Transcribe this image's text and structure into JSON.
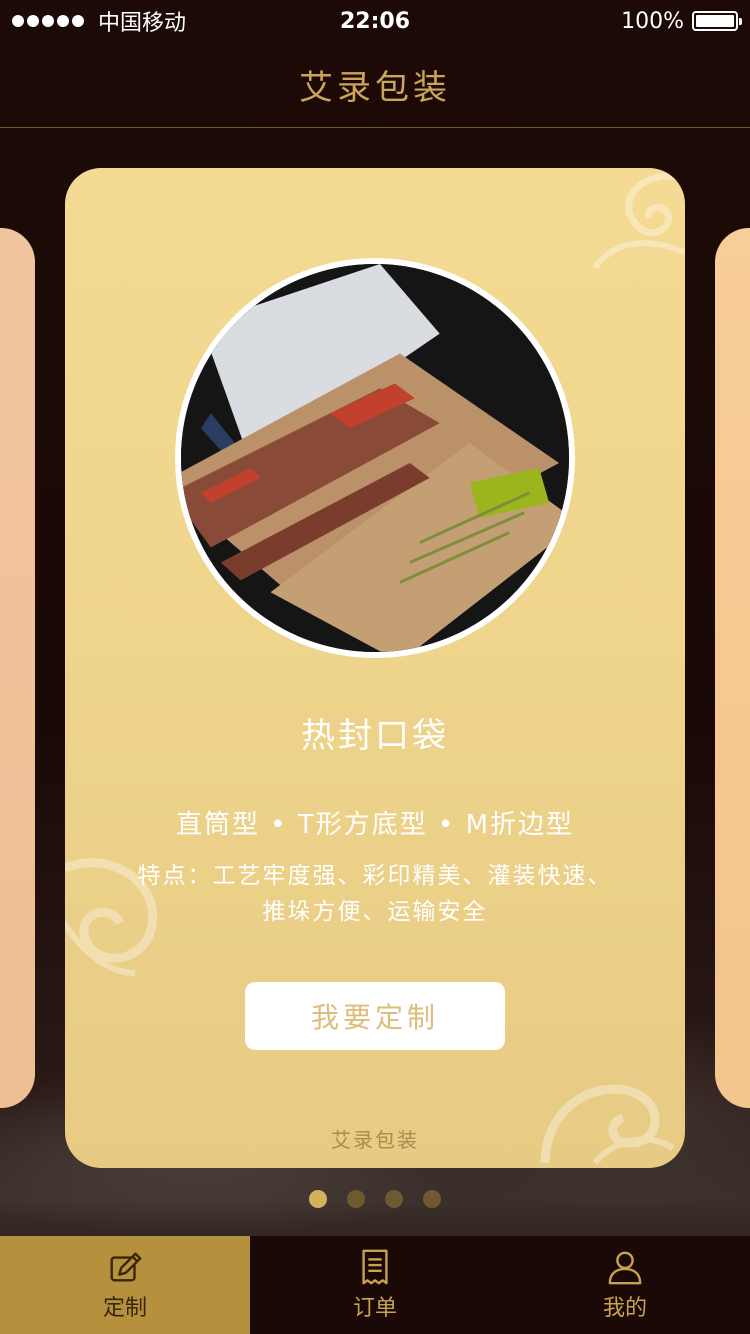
{
  "status_bar": {
    "carrier": "中国移动",
    "time": "22:06",
    "battery": "100%"
  },
  "nav": {
    "title": "艾录包装"
  },
  "card": {
    "title": "热封口袋",
    "types": "直筒型 • T形方底型 • M折边型",
    "features_line1": "特点：工艺牢度强、彩印精美、灌装快速、",
    "features_line2": "推垛方便、运输安全",
    "cta_label": "我要定制",
    "brand": "艾录包装"
  },
  "pager": {
    "count": 4,
    "active_index": 0
  },
  "tabs": [
    {
      "label": "定制",
      "icon": "pencil-icon",
      "active": true
    },
    {
      "label": "订单",
      "icon": "receipt-icon",
      "active": false
    },
    {
      "label": "我的",
      "icon": "user-icon",
      "active": false
    }
  ],
  "colors": {
    "accent_gold": "#cba55a",
    "tab_active_bg": "#b5913e",
    "card_bg": "#f0d58d",
    "background": "#1b0907"
  }
}
